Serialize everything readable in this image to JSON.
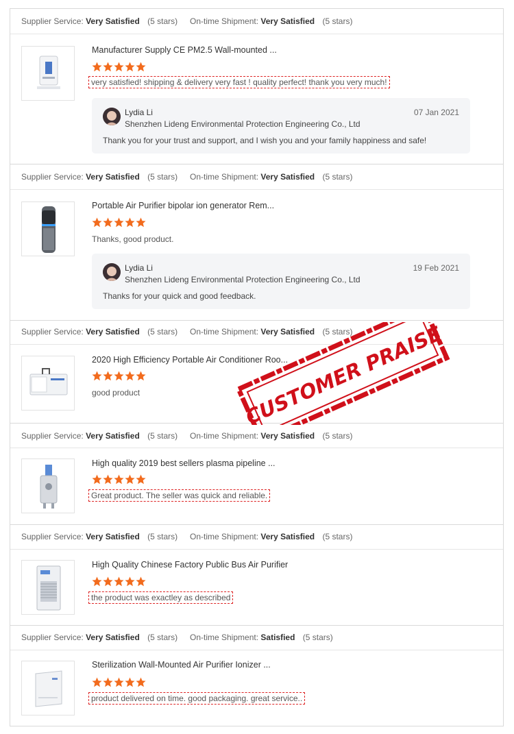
{
  "colors": {
    "star": "#f26b1d",
    "stamp": "#d0101a",
    "highlight_border": "#d22222"
  },
  "reviews": [
    {
      "supplier_label": "Supplier Service:",
      "supplier_value": "Very Satisfied",
      "supplier_stars": "(5 stars)",
      "shipment_label": "On-time Shipment:",
      "shipment_value": "Very Satisfied",
      "shipment_stars": "(5 stars)",
      "product_title": "Manufacturer Supply CE PM2.5 Wall-mounted ...",
      "rating": 5,
      "comment": "very satisfied! shipping & delivery very fast ! quality perfect! thank you very much!",
      "image_icon": "wall-air-purifier-icon",
      "reply": {
        "name": "Lydia Li",
        "company": "Shenzhen Lideng Environmental Protection Engineering Co., Ltd",
        "date": "07 Jan 2021",
        "text": "Thank you for your trust and support, and I wish you and your family happiness and safe!"
      }
    },
    {
      "supplier_label": "Supplier Service:",
      "supplier_value": "Very Satisfied",
      "supplier_stars": "(5 stars)",
      "shipment_label": "On-time Shipment:",
      "shipment_value": "Very Satisfied",
      "shipment_stars": "(5 stars)",
      "product_title": "Portable Air Purifier bipolar ion generator Rem...",
      "rating": 5,
      "comment": "Thanks, good product.",
      "image_icon": "portable-purifier-icon",
      "reply": {
        "name": "Lydia Li",
        "company": "Shenzhen Lideng Environmental Protection Engineering Co., Ltd",
        "date": "19 Feb 2021",
        "text": "Thanks for your quick and good feedback."
      }
    },
    {
      "supplier_label": "Supplier Service:",
      "supplier_value": "Very Satisfied",
      "supplier_stars": "(5 stars)",
      "shipment_label": "On-time Shipment:",
      "shipment_value": "Very Satisfied",
      "shipment_stars": "(5 stars)",
      "product_title": "2020 High Efficiency Portable Air Conditioner Roo...",
      "rating": 5,
      "comment": "good product",
      "image_icon": "air-conditioner-icon"
    },
    {
      "supplier_label": "Supplier Service:",
      "supplier_value": "Very Satisfied",
      "supplier_stars": "(5 stars)",
      "shipment_label": "On-time Shipment:",
      "shipment_value": "Very Satisfied",
      "shipment_stars": "(5 stars)",
      "product_title": "High quality 2019 best sellers plasma pipeline ...",
      "rating": 5,
      "comment": "Great product. The seller was quick and reliable.",
      "image_icon": "plasma-pipeline-icon"
    },
    {
      "supplier_label": "Supplier Service:",
      "supplier_value": "Very Satisfied",
      "supplier_stars": "(5 stars)",
      "shipment_label": "On-time Shipment:",
      "shipment_value": "Very Satisfied",
      "shipment_stars": "(5 stars)",
      "product_title": "High Quality Chinese Factory Public Bus Air Purifier",
      "rating": 5,
      "comment": "the product was exactley as described",
      "image_icon": "bus-purifier-icon"
    },
    {
      "supplier_label": "Supplier Service:",
      "supplier_value": "Very Satisfied",
      "supplier_stars": "(5 stars)",
      "shipment_label": "On-time Shipment:",
      "shipment_value": "Satisfied",
      "shipment_stars": "(5 stars)",
      "product_title": "Sterilization Wall-Mounted Air Purifier Ionizer ...",
      "rating": 5,
      "comment": "product delivered on time. good packaging. great service..",
      "image_icon": "wall-ionizer-icon"
    }
  ],
  "stamp": {
    "text": "CUSTOMER PRAISE"
  }
}
